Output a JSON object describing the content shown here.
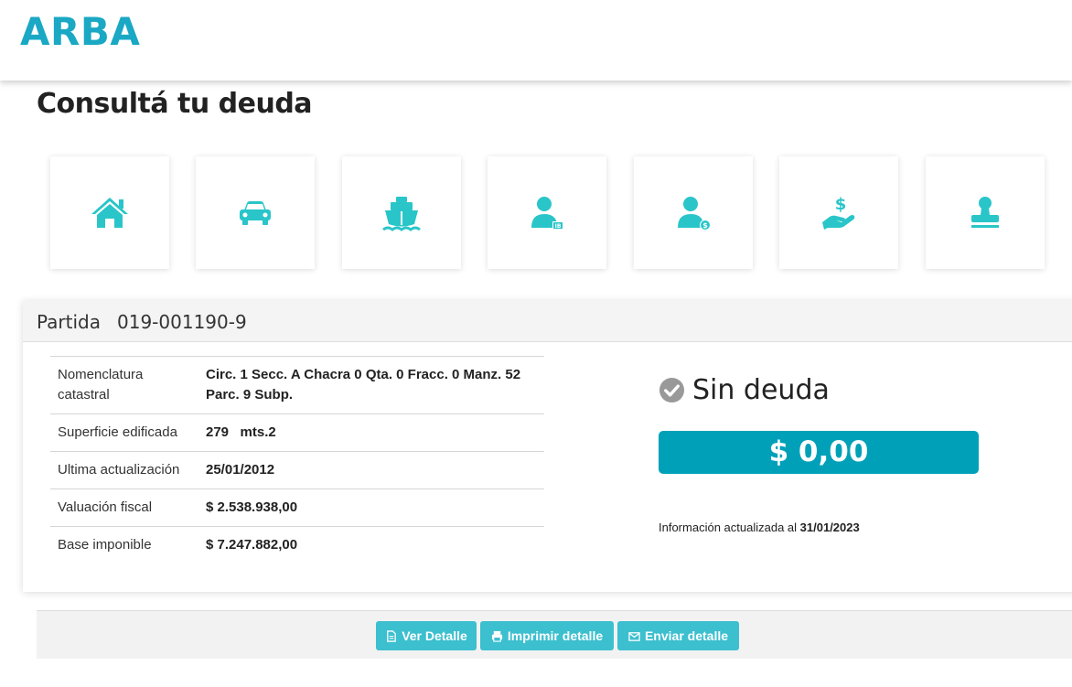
{
  "header": {
    "logo": "ARBA"
  },
  "page": {
    "title": "Consultá tu deuda"
  },
  "tiles": [
    {
      "icon": "house-icon"
    },
    {
      "icon": "car-icon"
    },
    {
      "icon": "boat-icon"
    },
    {
      "icon": "person-ib-icon"
    },
    {
      "icon": "person-dollar-icon"
    },
    {
      "icon": "hand-dollar-icon"
    },
    {
      "icon": "stamp-icon"
    }
  ],
  "partida": {
    "label": "Partida",
    "number": "019-001190-9"
  },
  "details": [
    {
      "key": "Nomenclatura catastral",
      "value": "Circ. 1 Secc. A Chacra 0 Qta. 0 Fracc. 0 Manz. 52 Parc. 9 Subp."
    },
    {
      "key": "Superficie edificada",
      "value": "279   mts.2"
    },
    {
      "key": "Ultima actualización",
      "value": "25/01/2012"
    },
    {
      "key": "Valuación fiscal",
      "value": "$ 2.538.938,00"
    },
    {
      "key": "Base imponible",
      "value": "$ 7.247.882,00"
    }
  ],
  "status": {
    "text": "Sin deuda",
    "icon": "check-circle-icon"
  },
  "amount": "$ 0,00",
  "updated": {
    "prefix": "Información actualizada al ",
    "date": "31/01/2023"
  },
  "buttons": {
    "ver": "Ver Detalle",
    "imprimir": "Imprimir detalle",
    "enviar": "Enviar detalle"
  },
  "colors": {
    "brand": "#1aa8c4",
    "icon": "#29c5c9",
    "amount_bg": "#00a1b8",
    "button": "#3cbfcf"
  }
}
